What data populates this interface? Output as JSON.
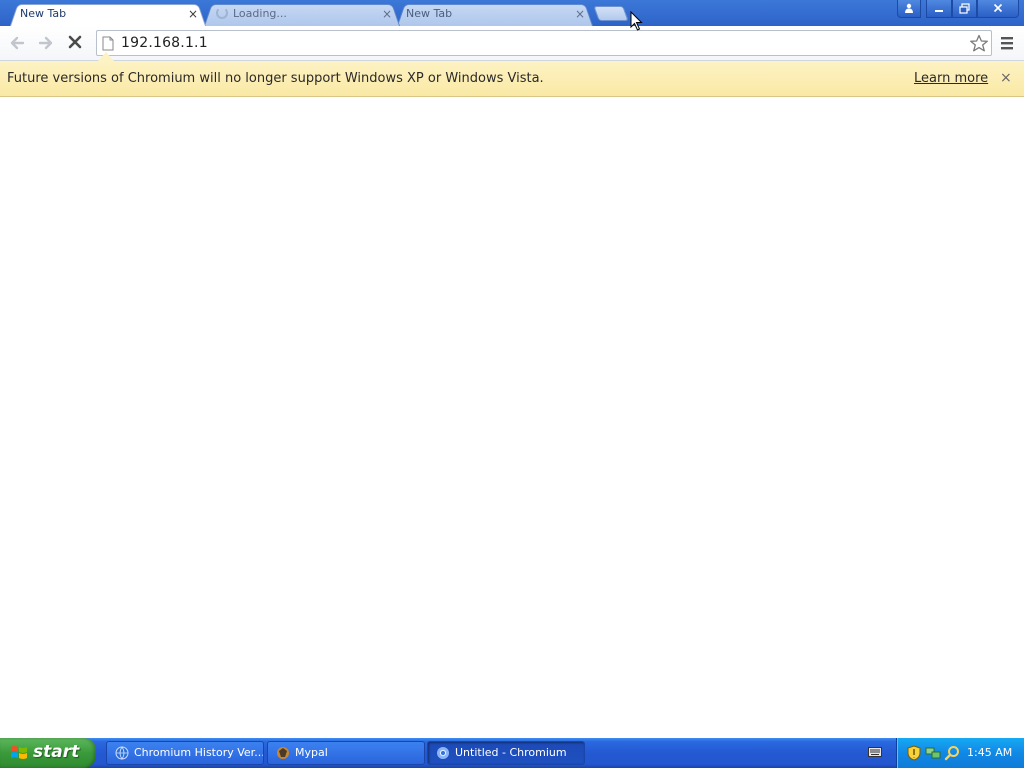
{
  "browser": {
    "tabs": [
      {
        "title": "New Tab",
        "active": true
      },
      {
        "title": "Loading...",
        "active": false,
        "loading": true
      },
      {
        "title": "New Tab",
        "active": false
      }
    ],
    "tab_close_glyph": "×",
    "window_controls": [
      "profile-icon",
      "minimize-icon",
      "restore-icon",
      "close-icon"
    ]
  },
  "toolbar": {
    "url": "192.168.1.1",
    "icons": [
      "back-arrow-icon",
      "forward-arrow-icon",
      "stop-icon",
      "page-icon",
      "star-icon",
      "menu-icon"
    ]
  },
  "infobar": {
    "message": "Future versions of Chromium will no longer support Windows XP or Windows Vista.",
    "link": "Learn more",
    "close_glyph": "×"
  },
  "taskbar": {
    "start_label": "start",
    "items": [
      {
        "label": "Chromium History Ver...",
        "icon": "globe-icon",
        "active": false
      },
      {
        "label": "Mypal",
        "icon": "mypal-icon",
        "active": false
      },
      {
        "label": "Untitled - Chromium",
        "icon": "chromium-icon",
        "active": true
      }
    ],
    "tray_icons": [
      "keyboard-icon",
      "security-shield-icon",
      "network-icon",
      "search-icon"
    ],
    "clock": "1:45 AM"
  },
  "colors": {
    "titlebar": "#2d63c8",
    "infobar": "#fbeeb4",
    "taskbar": "#2459d2",
    "start_button": "#3a9a3a",
    "tray": "#1188e6"
  }
}
